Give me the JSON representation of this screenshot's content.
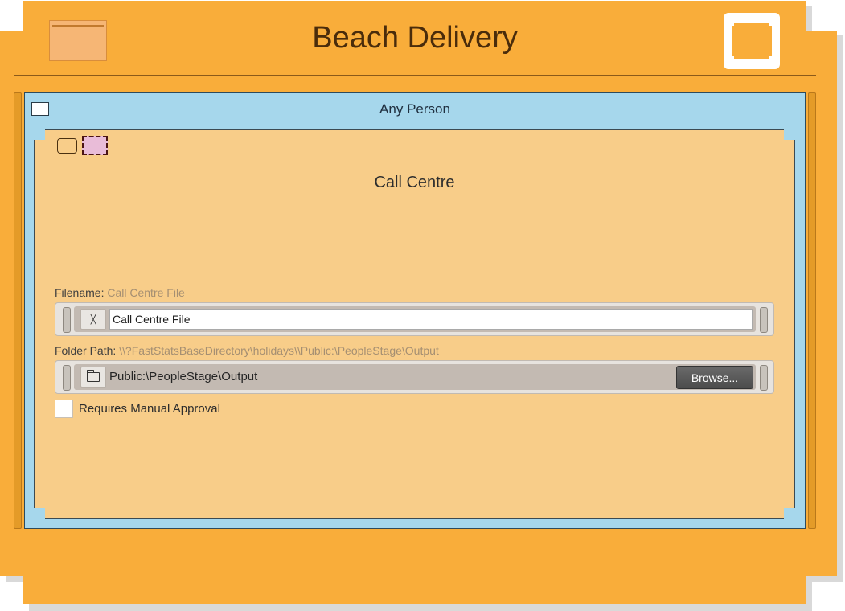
{
  "window": {
    "title": "Beach Delivery"
  },
  "selection_panel": {
    "title": "Any Person"
  },
  "action_panel": {
    "title": "Call Centre",
    "filename": {
      "label": "Filename:",
      "hint": "Call Centre File",
      "value": "Call Centre File",
      "icon": "pen-icon"
    },
    "folder_path": {
      "label": "Folder Path:",
      "hint": "\\\\?FastStatsBaseDirectory\\holidays\\\\Public:\\PeopleStage\\Output",
      "value": "Public:\\PeopleStage\\Output",
      "icon": "folder-icon",
      "browse_label": "Browse..."
    },
    "manual_approval": {
      "label": "Requires Manual Approval",
      "checked": false
    }
  },
  "colors": {
    "card": "#f9ad3a",
    "selection_panel": "#a6d7ec",
    "action_panel": "#f8cd89",
    "title_text": "#4a2c0b"
  }
}
